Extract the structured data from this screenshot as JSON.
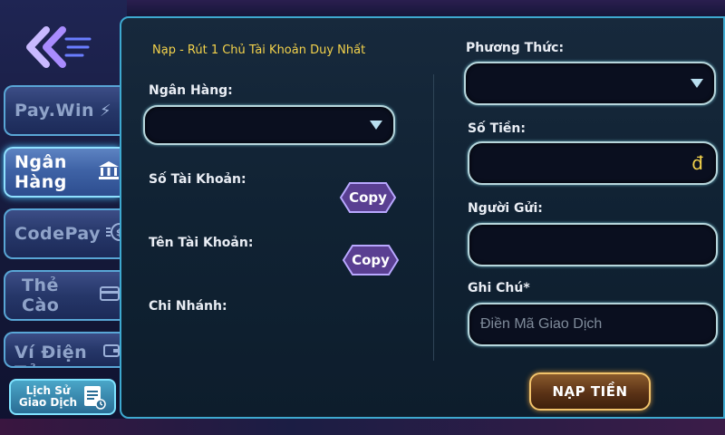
{
  "sidebar": {
    "tabs": [
      {
        "label": "Pay.Win",
        "icon": "lightning-icon"
      },
      {
        "label": "Ngân Hàng",
        "icon": "bank-icon"
      },
      {
        "label": "CodePay",
        "icon": "coin-icon"
      },
      {
        "label": "Thẻ Cào",
        "icon": "card-icon"
      },
      {
        "label": "Ví Điện Tử",
        "icon": "wallet-icon"
      }
    ],
    "active_tab": "Ngân Hàng",
    "history": {
      "line1": "Lịch Sử",
      "line2": "Giao Dịch"
    },
    "help": "?"
  },
  "form": {
    "notice": "Nạp - Rút 1 Chủ Tài Khoản Duy Nhất",
    "bank_label": "Ngân Hàng:",
    "account_number_label": "Số Tài Khoản:",
    "account_name_label": "Tên Tài Khoản:",
    "branch_label": "Chi Nhánh:",
    "copy_label": "Copy",
    "method_label": "Phương Thức:",
    "amount_label": "Số Tiền:",
    "currency": "đ",
    "sender_label": "Người Gửi:",
    "note_label": "Ghi Chú*",
    "note_placeholder": "Điền Mã Giao Dịch",
    "submit_label": "NẠP TIỀN"
  },
  "colors": {
    "accent_yellow": "#f3d24b",
    "panel_border": "#3ea9d0",
    "active_tab": "#3f63a6",
    "submit_border": "#f2c36b"
  }
}
